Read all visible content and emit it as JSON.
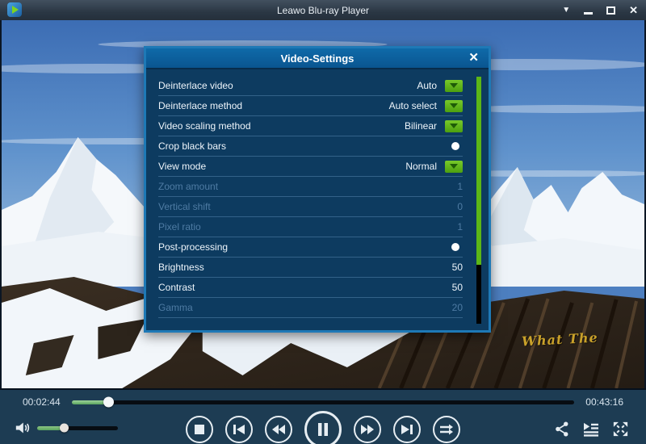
{
  "window": {
    "title": "Leawo Blu-ray Player"
  },
  "titlebar": {
    "icons": [
      "menu-chevron-icon",
      "minimize-icon",
      "maximize-icon",
      "close-icon"
    ],
    "menu_glyph": "▼",
    "close_glyph": "✕"
  },
  "dialog": {
    "title": "Video-Settings",
    "close_glyph": "✕",
    "rows": [
      {
        "label": "Deinterlace video",
        "type": "dropdown",
        "value": "Auto",
        "enabled": true
      },
      {
        "label": "Deinterlace method",
        "type": "dropdown",
        "value": "Auto select",
        "enabled": true
      },
      {
        "label": "Video scaling method",
        "type": "dropdown",
        "value": "Bilinear",
        "enabled": true
      },
      {
        "label": "Crop black bars",
        "type": "toggle",
        "value": "on",
        "enabled": true
      },
      {
        "label": "View mode",
        "type": "dropdown",
        "value": "Normal",
        "enabled": true
      },
      {
        "label": "Zoom amount",
        "type": "number",
        "value": "1",
        "enabled": false
      },
      {
        "label": "Vertical shift",
        "type": "number",
        "value": "0",
        "enabled": false
      },
      {
        "label": "Pixel ratio",
        "type": "number",
        "value": "1",
        "enabled": false
      },
      {
        "label": "Post-processing",
        "type": "toggle",
        "value": "on",
        "enabled": true
      },
      {
        "label": "Brightness",
        "type": "number",
        "value": "50",
        "enabled": true
      },
      {
        "label": "Contrast",
        "type": "number",
        "value": "50",
        "enabled": true
      },
      {
        "label": "Gamma",
        "type": "number",
        "value": "20",
        "enabled": false
      }
    ],
    "scrollbar_thumb_percent": 76
  },
  "player": {
    "elapsed": "00:02:44",
    "total": "00:43:16",
    "progress_percent": 7.3,
    "volume_percent": 33,
    "buttons": [
      "stop",
      "previous",
      "rewind",
      "pause",
      "fast-forward",
      "next",
      "play-order"
    ],
    "right_buttons": [
      "share",
      "playlist",
      "fullscreen"
    ]
  },
  "watermark": {
    "text": "What The"
  },
  "colors": {
    "accent_green": "#5cb616",
    "dialog_border_blue": "#1e79b6",
    "dialog_body": "#0d3b60",
    "header_blue": "#0c5f9e",
    "controls_bar": "#1d3c53",
    "titlebar": "#2b3744",
    "progress_green": "#5aa45e",
    "watermark_gold": "#c9a12a",
    "disabled_text": "#4e7ba3"
  }
}
